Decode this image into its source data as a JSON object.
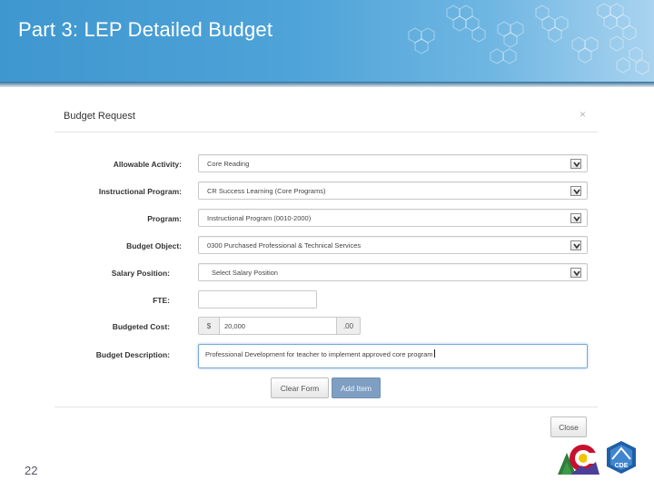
{
  "slide": {
    "title": "Part 3: LEP Detailed Budget",
    "page_number": "22"
  },
  "modal": {
    "title": "Budget Request",
    "close_icon": "×",
    "fields": {
      "allowable_activity": {
        "label": "Allowable Activity:",
        "value": "Core Reading"
      },
      "instructional_program": {
        "label": "Instructional Program:",
        "value": "CR Success Learning (Core Programs)"
      },
      "program": {
        "label": "Program:",
        "value": "Instructional Program (0010-2000)"
      },
      "budget_object": {
        "label": "Budget Object:",
        "value": "0300 Purchased Professional & Technical Services"
      },
      "salary_position": {
        "label": "Salary Position:",
        "value": "Select Salary Position"
      },
      "fte": {
        "label": "FTE:",
        "value": ""
      },
      "budgeted_cost": {
        "label": "Budgeted Cost:",
        "prefix": "$",
        "value": "20,000",
        "suffix": ".00"
      },
      "budget_description": {
        "label": "Budget Description:",
        "value": "Professional Development for teacher to implement approved core program"
      }
    },
    "buttons": {
      "clear": "Clear Form",
      "add": "Add Item",
      "close": "Close"
    }
  },
  "logos": {
    "left": "colorado-logo",
    "right": "cde-logo",
    "right_text": "CDE"
  },
  "colors": {
    "banner": "#4ea3d8",
    "add_button": "#7f9fc2",
    "focus_border": "#74a8d6"
  }
}
